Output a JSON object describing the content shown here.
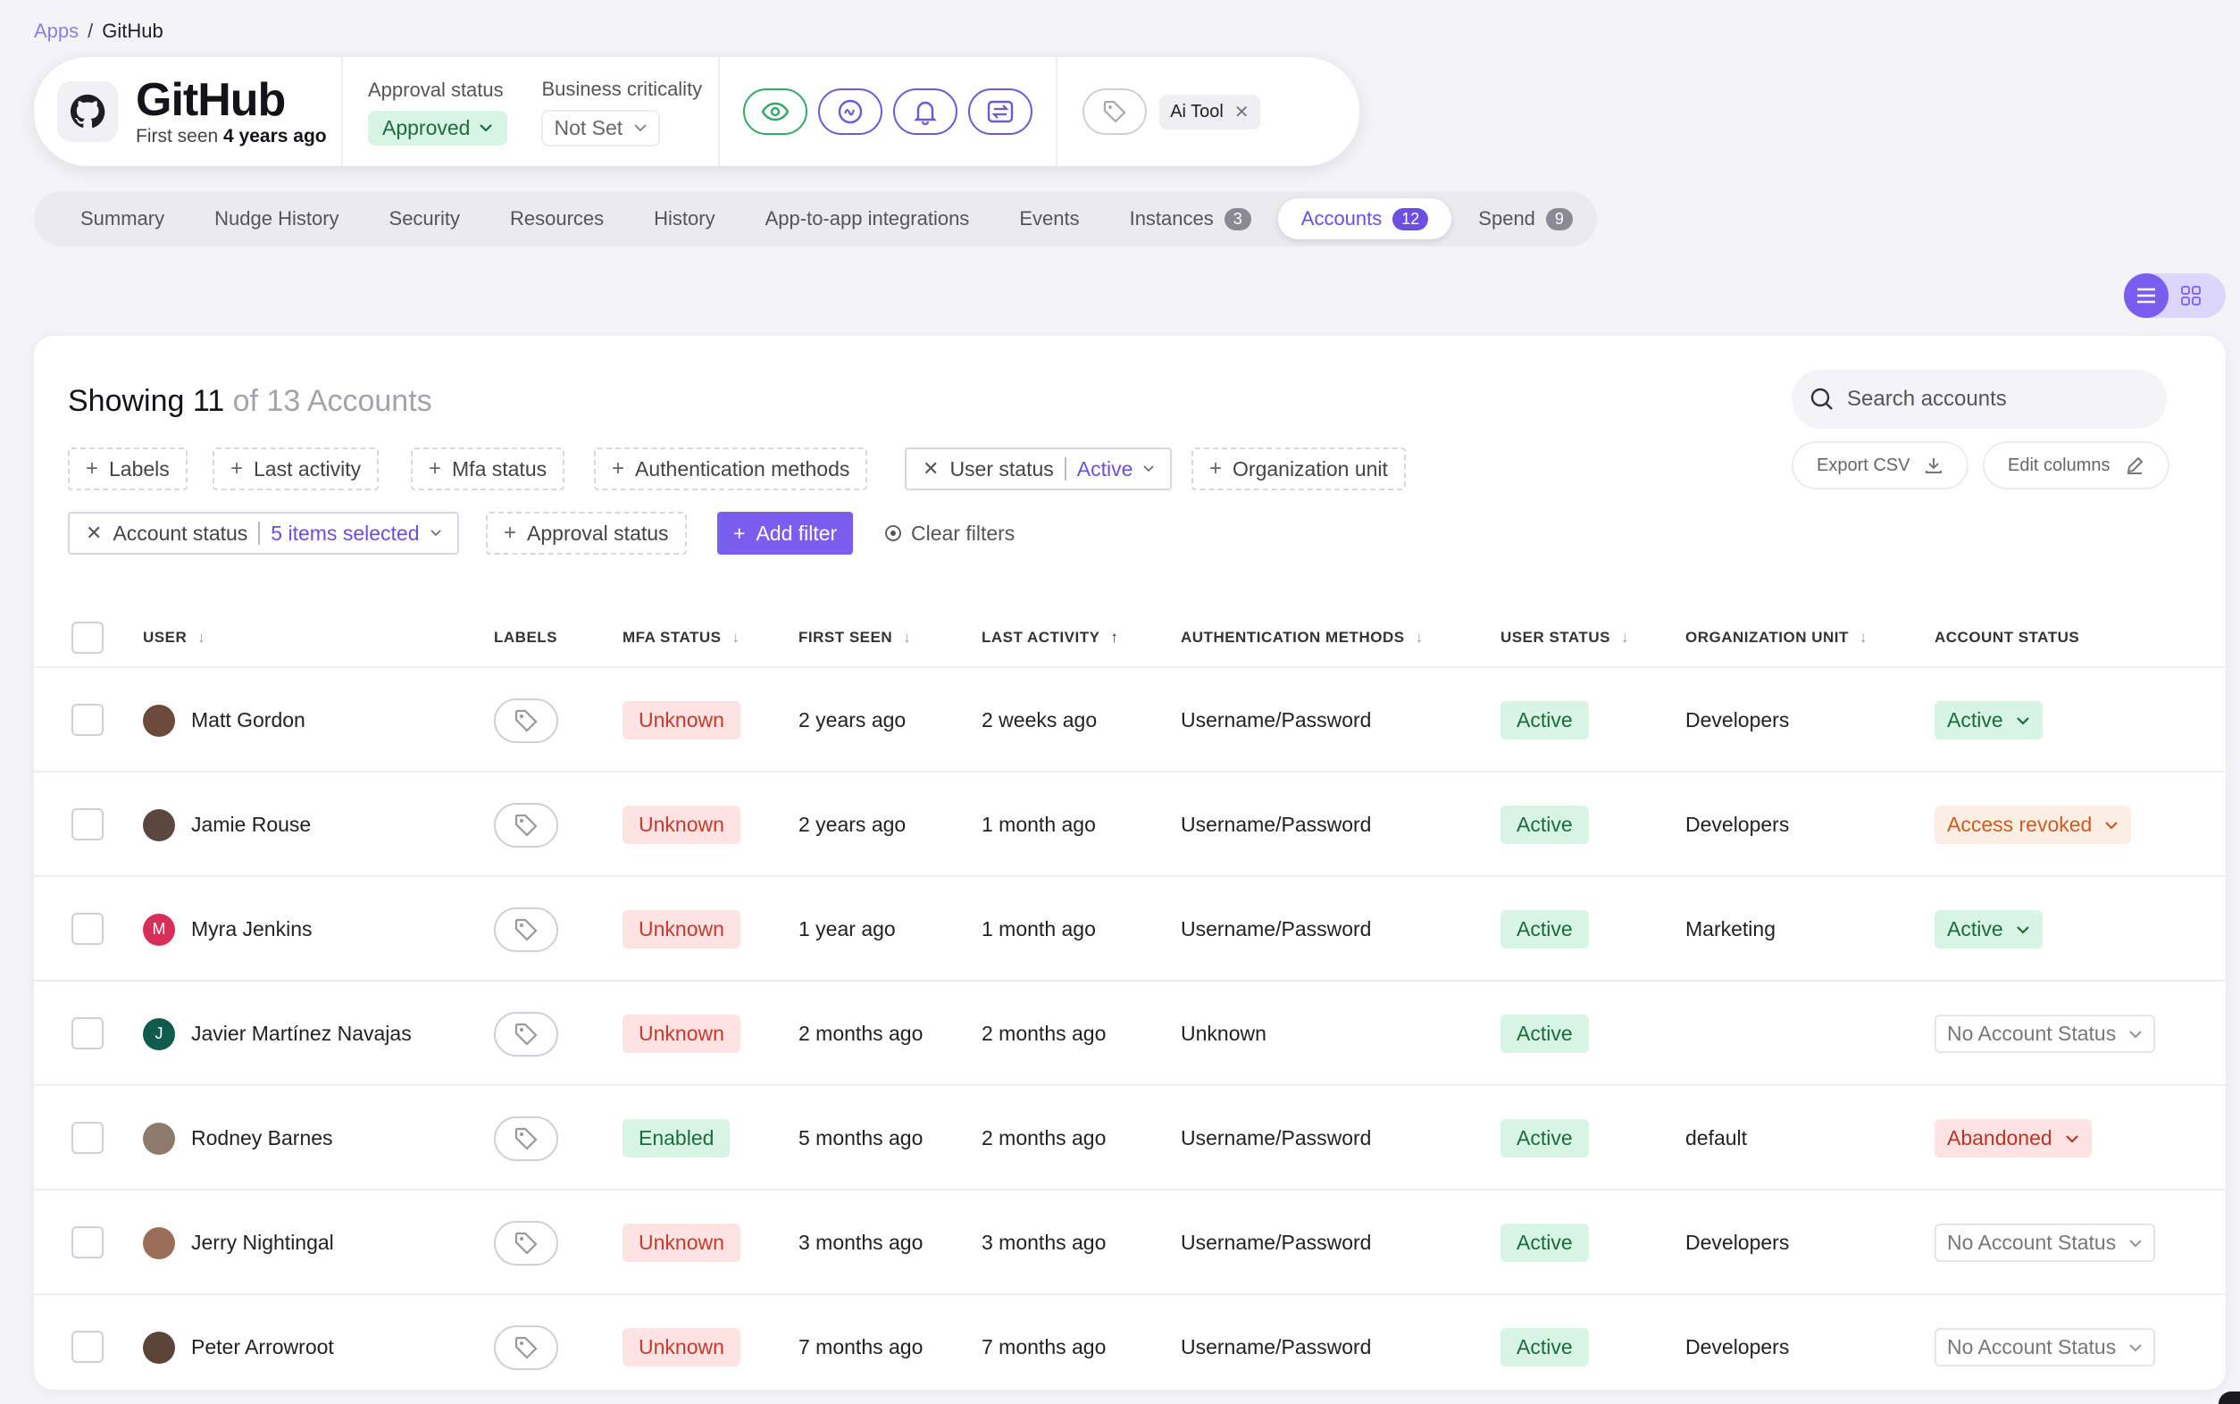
{
  "breadcrumb": {
    "parent": "Apps",
    "separator": "/",
    "current": "GitHub"
  },
  "app": {
    "name": "GitHub",
    "first_seen_prefix": "First seen",
    "first_seen_value": "4 years ago",
    "approval_label": "Approval status",
    "approval_value": "Approved",
    "criticality_label": "Business criticality",
    "criticality_value": "Not Set",
    "tag": "Ai Tool",
    "action_icons": [
      "eye-icon",
      "chat-icon",
      "bell-icon",
      "sync-icon"
    ]
  },
  "tabs": [
    {
      "label": "Summary"
    },
    {
      "label": "Nudge History"
    },
    {
      "label": "Security"
    },
    {
      "label": "Resources"
    },
    {
      "label": "History"
    },
    {
      "label": "App-to-app integrations"
    },
    {
      "label": "Events"
    },
    {
      "label": "Instances",
      "badge": "3"
    },
    {
      "label": "Accounts",
      "badge": "12",
      "active": true
    },
    {
      "label": "Spend",
      "badge": "9"
    }
  ],
  "summary": {
    "showing_prefix": "Showing",
    "shown": "11",
    "of_text": "of 13 Accounts"
  },
  "search": {
    "placeholder": "Search accounts"
  },
  "tools": {
    "export": "Export CSV",
    "edit_columns": "Edit columns"
  },
  "filters": {
    "labels": "Labels",
    "last_activity": "Last activity",
    "mfa_status": "Mfa status",
    "auth_methods": "Authentication methods",
    "user_status_name": "User status",
    "user_status_value": "Active",
    "org_unit": "Organization unit",
    "account_status_name": "Account status",
    "account_status_value": "5 items selected",
    "approval_status": "Approval status",
    "add_filter": "Add filter",
    "clear_filters": "Clear filters"
  },
  "columns": {
    "user": "USER",
    "labels": "LABELS",
    "mfa": "MFA STATUS",
    "first_seen": "FIRST SEEN",
    "last_activity": "LAST ACTIVITY",
    "auth": "AUTHENTICATION METHODS",
    "user_status": "USER STATUS",
    "org_unit": "ORGANIZATION UNIT",
    "account_status": "ACCOUNT STATUS"
  },
  "rows": [
    {
      "name": "Matt Gordon",
      "avatar_color": "#6b4a3a",
      "initial": "",
      "mfa": "Unknown",
      "first_seen": "2 years ago",
      "last_activity": "2 weeks ago",
      "auth": "Username/Password",
      "user_status": "Active",
      "org_unit": "Developers",
      "account_status": "Active"
    },
    {
      "name": "Jamie Rouse",
      "avatar_color": "#5a4740",
      "initial": "",
      "mfa": "Unknown",
      "first_seen": "2 years ago",
      "last_activity": "1 month ago",
      "auth": "Username/Password",
      "user_status": "Active",
      "org_unit": "Developers",
      "account_status": "Access revoked"
    },
    {
      "name": "Myra Jenkins",
      "avatar_color": "#d92d5a",
      "initial": "M",
      "mfa": "Unknown",
      "first_seen": "1 year ago",
      "last_activity": "1 month ago",
      "auth": "Username/Password",
      "user_status": "Active",
      "org_unit": "Marketing",
      "account_status": "Active"
    },
    {
      "name": "Javier Martínez Navajas",
      "avatar_color": "#0f5c4d",
      "initial": "J",
      "mfa": "Unknown",
      "first_seen": "2 months ago",
      "last_activity": "2 months ago",
      "auth": "Unknown",
      "user_status": "Active",
      "org_unit": "",
      "account_status": "No Account Status"
    },
    {
      "name": "Rodney Barnes",
      "avatar_color": "#8c7a6a",
      "initial": "",
      "mfa": "Enabled",
      "first_seen": "5 months ago",
      "last_activity": "2 months ago",
      "auth": "Username/Password",
      "user_status": "Active",
      "org_unit": "default",
      "account_status": "Abandoned"
    },
    {
      "name": "Jerry Nightingal",
      "avatar_color": "#9a6e58",
      "initial": "",
      "mfa": "Unknown",
      "first_seen": "3 months ago",
      "last_activity": "3 months ago",
      "auth": "Username/Password",
      "user_status": "Active",
      "org_unit": "Developers",
      "account_status": "No Account Status"
    },
    {
      "name": "Peter Arrowroot",
      "avatar_color": "#5b4536",
      "initial": "",
      "mfa": "Unknown",
      "first_seen": "7 months ago",
      "last_activity": "7 months ago",
      "auth": "Username/Password",
      "user_status": "Active",
      "org_unit": "Developers",
      "account_status": "No Account Status"
    }
  ]
}
